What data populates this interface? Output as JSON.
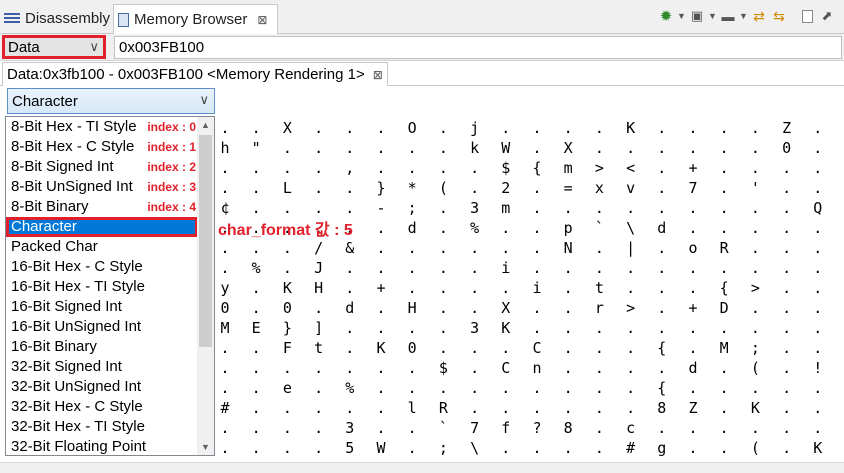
{
  "tabs": {
    "disassembly": "Disassembly",
    "memory_browser": "Memory Browser",
    "close_glyph": "⊠"
  },
  "address_bar": {
    "mode": "Data",
    "address": "0x003FB100"
  },
  "rendering_tab": {
    "label": "Data:0x3fb100 - 0x003FB100 <Memory Rendering 1>",
    "close_glyph": "⊠"
  },
  "format_combo": {
    "selected": "Character"
  },
  "dropdown": {
    "items": [
      {
        "label": "8-Bit Hex - TI Style",
        "index": "index : 0"
      },
      {
        "label": "8-Bit Hex - C Style",
        "index": "index : 1"
      },
      {
        "label": "8-Bit Signed Int",
        "index": "index : 2"
      },
      {
        "label": "8-Bit UnSigned Int",
        "index": "index : 3"
      },
      {
        "label": "8-Bit Binary",
        "index": "index : 4"
      },
      {
        "label": "Character",
        "index": ""
      },
      {
        "label": "Packed Char",
        "index": ""
      },
      {
        "label": "16-Bit Hex - C Style",
        "index": ""
      },
      {
        "label": "16-Bit Hex - TI Style",
        "index": ""
      },
      {
        "label": "16-Bit Signed Int",
        "index": ""
      },
      {
        "label": "16-Bit UnSigned Int",
        "index": ""
      },
      {
        "label": "16-Bit Binary",
        "index": ""
      },
      {
        "label": "32-Bit Signed Int",
        "index": ""
      },
      {
        "label": "32-Bit UnSigned Int",
        "index": ""
      },
      {
        "label": "32-Bit Hex - C Style",
        "index": ""
      },
      {
        "label": "32-Bit Hex - TI Style",
        "index": ""
      },
      {
        "label": "32-Bit Floating Point",
        "index": ""
      }
    ],
    "selected_index": 5
  },
  "annotation": "char_format 값 : 5",
  "memory_grid": {
    "col_start": 215,
    "rows": [
      ". . X . . . O . j . . . . K . . . . Z . . k",
      "h \" . . . . . . k W . X . . . . . . 0 . . .",
      ". . . . , . . . . $ { m > < . + . . . . . .",
      ". . L . . } * ( . 2 . = x v . 7 . ' . . . .",
      "¢ . . . . - ; . 3 m . . . . . . . . . Q . .",
      ". . . . . . d . % . . p ` \\ d . . . . . . .",
      ". . . / & . . . . . . N . | . o R . . . . *",
      ". % . J . . . . . i . . . . . . . . . . . ?",
      "y . K H . + . . . . i . t . . . { > . . . .",
      "0 . 0 . d . H . . X . . r > . + D . . . . .",
      "M E } ] . . . . 3 K . . . . . . . . . . { `",
      ". . F t . K 0 . . . C . . . { . M ; . . . .",
      ". . . . . . . $ . C n . . . . d . ( . ! . .",
      ". . e . % . . . . . . . . . { . . . . . . .",
      "# . . . . . l R . . . . . . 8 Z . K . . . .",
      ". . . . 3 . . ` 7 f ? 8 . c . . . . . . # ;",
      ". . . . 5 W . ; \\ . . . . # g . . ( . K . E"
    ]
  }
}
